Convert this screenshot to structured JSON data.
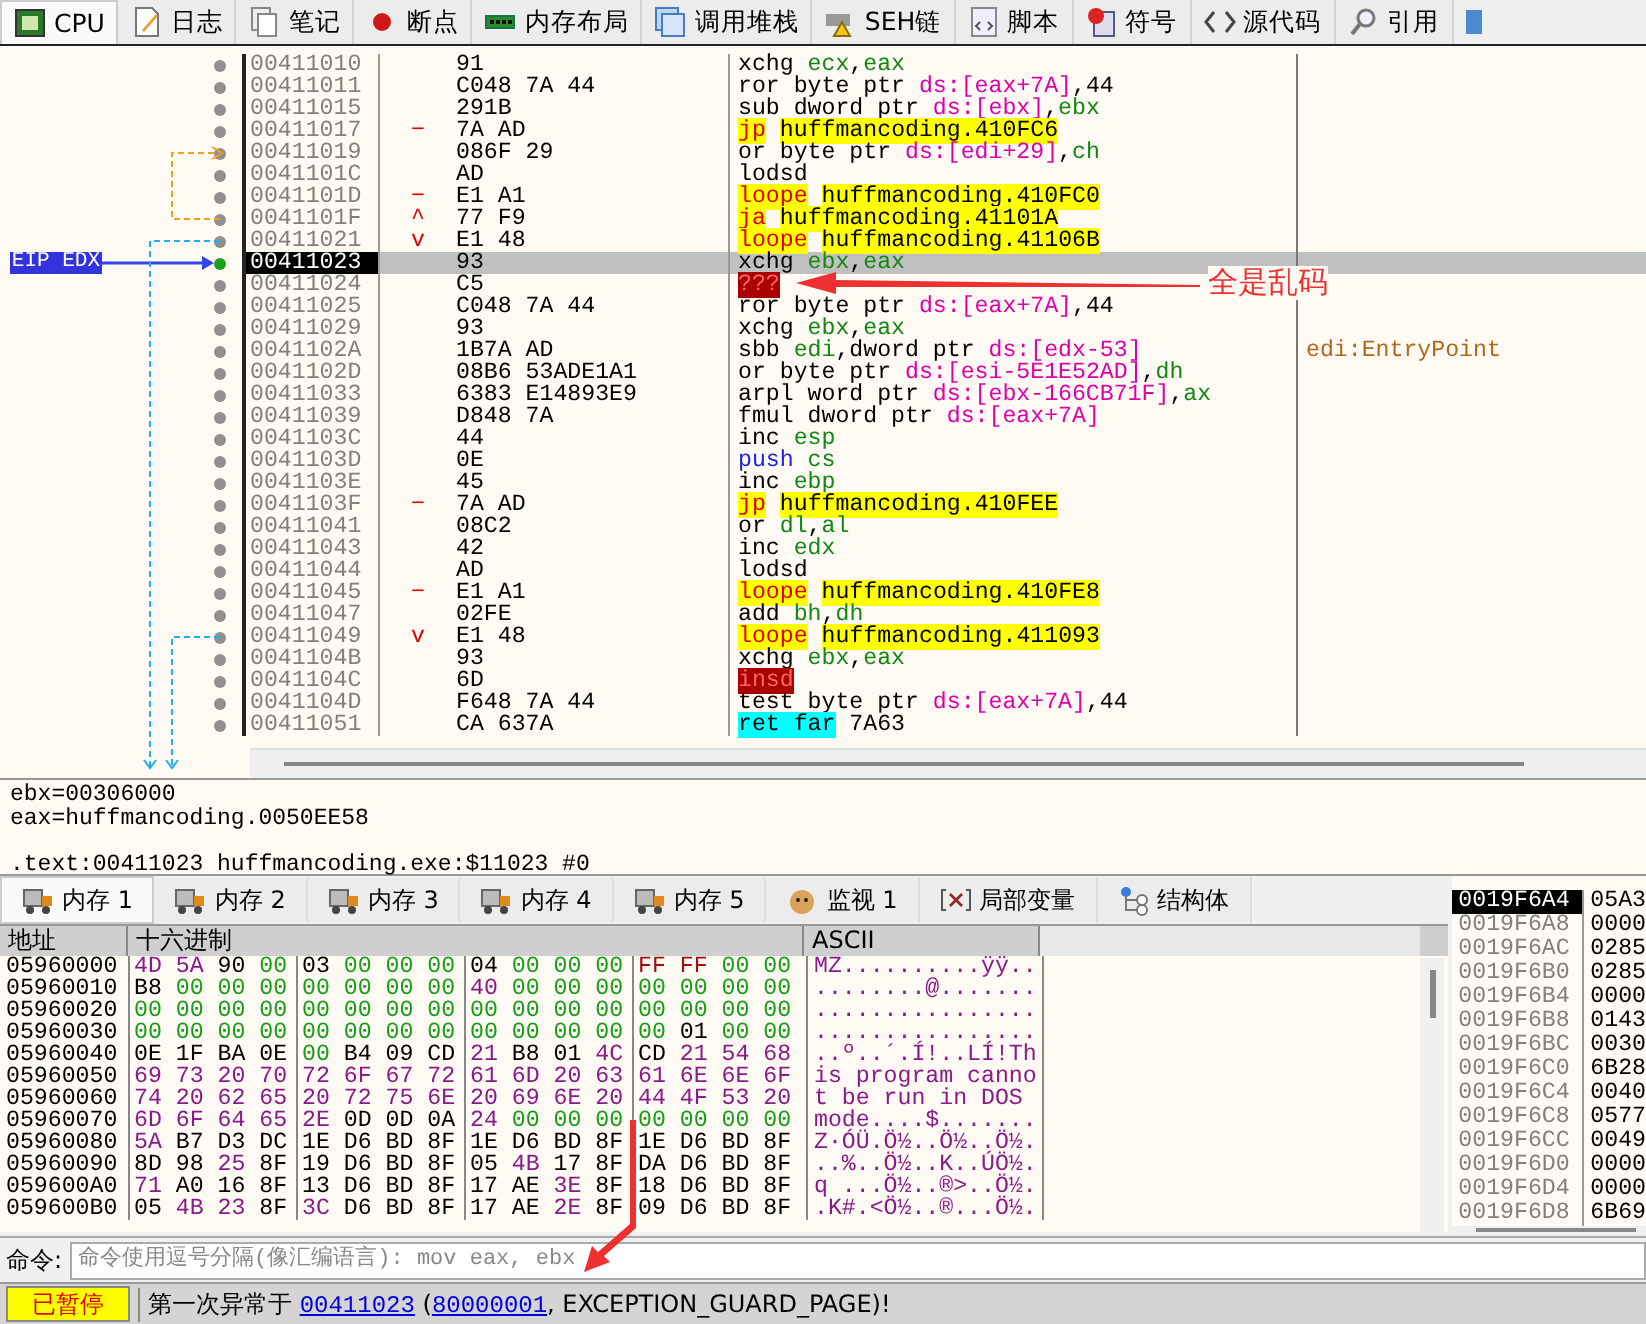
{
  "tabs": [
    {
      "label": "CPU",
      "selected": true
    },
    {
      "label": "日志",
      "selected": false
    },
    {
      "label": "笔记",
      "selected": false
    },
    {
      "label": "断点",
      "selected": false
    },
    {
      "label": "内存布局",
      "selected": false
    },
    {
      "label": "调用堆栈",
      "selected": false
    },
    {
      "label": "SEH链",
      "selected": false
    },
    {
      "label": "脚本",
      "selected": false
    },
    {
      "label": "符号",
      "selected": false
    },
    {
      "label": "源代码",
      "selected": false
    },
    {
      "label": "引用",
      "selected": false
    }
  ],
  "eip_label": "EIP EDX",
  "disassembly": [
    {
      "address": "00411010",
      "bytes": "91",
      "parts": [
        {
          "kind": "plain",
          "text": "xchg "
        },
        {
          "kind": "reg",
          "text": "ecx"
        },
        {
          "kind": "plain",
          "text": ","
        },
        {
          "kind": "reg",
          "text": "eax"
        }
      ],
      "selected": false
    },
    {
      "address": "00411011",
      "bytes": "C048 7A 44",
      "parts": [
        {
          "kind": "plain",
          "text": "ror byte ptr "
        },
        {
          "kind": "mem",
          "text": "ds:[eax+7A]"
        },
        {
          "kind": "plain",
          "text": ",44"
        }
      ],
      "selected": false
    },
    {
      "address": "00411015",
      "bytes": "291B",
      "parts": [
        {
          "kind": "plain",
          "text": "sub dword ptr "
        },
        {
          "kind": "mem",
          "text": "ds:[ebx]"
        },
        {
          "kind": "plain",
          "text": ","
        },
        {
          "kind": "reg",
          "text": "ebx"
        }
      ],
      "selected": false
    },
    {
      "address": "00411017",
      "jump": "−",
      "bytes": "7A AD",
      "parts": [
        {
          "kind": "jump",
          "text": "jp"
        },
        {
          "kind": "label",
          "text": "huffmancoding.410FC6"
        }
      ],
      "selected": false
    },
    {
      "address": "00411019",
      "bytes": "086F 29",
      "parts": [
        {
          "kind": "plain",
          "text": "or byte ptr "
        },
        {
          "kind": "mem",
          "text": "ds:[edi+29]"
        },
        {
          "kind": "plain",
          "text": ","
        },
        {
          "kind": "reg",
          "text": "ch"
        }
      ],
      "selected": false
    },
    {
      "address": "0041101C",
      "bytes": "AD",
      "parts": [
        {
          "kind": "plain",
          "text": "lodsd"
        }
      ],
      "selected": false
    },
    {
      "address": "0041101D",
      "jump": "−",
      "bytes": "E1 A1",
      "parts": [
        {
          "kind": "jump",
          "text": "loope"
        },
        {
          "kind": "label",
          "text": "huffmancoding.410FC0"
        }
      ],
      "selected": false
    },
    {
      "address": "0041101F",
      "jump": "^",
      "bytes": "77 F9",
      "parts": [
        {
          "kind": "jump",
          "text": "ja"
        },
        {
          "kind": "label",
          "text": "huffmancoding.41101A"
        }
      ],
      "selected": false
    },
    {
      "address": "00411021",
      "jump": "v",
      "bytes": "E1 48",
      "parts": [
        {
          "kind": "jump",
          "text": "loope"
        },
        {
          "kind": "label",
          "text": "huffmancoding.41106B"
        }
      ],
      "selected": false
    },
    {
      "address": "00411023",
      "bytes": "93",
      "parts": [
        {
          "kind": "plain",
          "text": "xchg "
        },
        {
          "kind": "reg",
          "text": "ebx"
        },
        {
          "kind": "plain",
          "text": ","
        },
        {
          "kind": "reg",
          "text": "eax"
        }
      ],
      "selected": true,
      "eip": true
    },
    {
      "address": "00411024",
      "bytes": "C5",
      "parts": [
        {
          "kind": "bad",
          "text": "???"
        }
      ],
      "selected": false
    },
    {
      "address": "00411025",
      "bytes": "C048 7A 44",
      "parts": [
        {
          "kind": "plain",
          "text": "ror byte ptr "
        },
        {
          "kind": "mem",
          "text": "ds:[eax+7A]"
        },
        {
          "kind": "plain",
          "text": ",44"
        }
      ],
      "selected": false
    },
    {
      "address": "00411029",
      "bytes": "93",
      "parts": [
        {
          "kind": "plain",
          "text": "xchg "
        },
        {
          "kind": "reg",
          "text": "ebx"
        },
        {
          "kind": "plain",
          "text": ","
        },
        {
          "kind": "reg",
          "text": "eax"
        }
      ],
      "selected": false
    },
    {
      "address": "0041102A",
      "bytes": "1B7A AD",
      "parts": [
        {
          "kind": "plain",
          "text": "sbb "
        },
        {
          "kind": "reg",
          "text": "edi"
        },
        {
          "kind": "plain",
          "text": ",dword ptr "
        },
        {
          "kind": "mem",
          "text": "ds:[edx-53]"
        }
      ],
      "comment": "edi:EntryPoint",
      "selected": false
    },
    {
      "address": "0041102D",
      "bytes": "08B6 53ADE1A1",
      "parts": [
        {
          "kind": "plain",
          "text": "or byte ptr "
        },
        {
          "kind": "mem",
          "text": "ds:[esi-5E1E52AD]"
        },
        {
          "kind": "plain",
          "text": ","
        },
        {
          "kind": "reg",
          "text": "dh"
        }
      ],
      "selected": false
    },
    {
      "address": "00411033",
      "bytes": "6383 E14893E9",
      "parts": [
        {
          "kind": "plain",
          "text": "arpl word ptr "
        },
        {
          "kind": "mem",
          "text": "ds:[ebx-166CB71F]"
        },
        {
          "kind": "plain",
          "text": ","
        },
        {
          "kind": "reg",
          "text": "ax"
        }
      ],
      "selected": false
    },
    {
      "address": "00411039",
      "bytes": "D848 7A",
      "parts": [
        {
          "kind": "plain",
          "text": "fmul dword ptr "
        },
        {
          "kind": "mem",
          "text": "ds:[eax+7A]"
        }
      ],
      "selected": false
    },
    {
      "address": "0041103C",
      "bytes": "44",
      "parts": [
        {
          "kind": "plain",
          "text": "inc "
        },
        {
          "kind": "reg",
          "text": "esp"
        }
      ],
      "selected": false
    },
    {
      "address": "0041103D",
      "bytes": "0E",
      "parts": [
        {
          "kind": "push",
          "text": "push "
        },
        {
          "kind": "reg",
          "text": "cs"
        }
      ],
      "selected": false
    },
    {
      "address": "0041103E",
      "bytes": "45",
      "parts": [
        {
          "kind": "plain",
          "text": "inc "
        },
        {
          "kind": "reg",
          "text": "ebp"
        }
      ],
      "selected": false
    },
    {
      "address": "0041103F",
      "jump": "−",
      "bytes": "7A AD",
      "parts": [
        {
          "kind": "jump",
          "text": "jp"
        },
        {
          "kind": "label",
          "text": "huffmancoding.410FEE"
        }
      ],
      "selected": false
    },
    {
      "address": "00411041",
      "bytes": "08C2",
      "parts": [
        {
          "kind": "plain",
          "text": "or "
        },
        {
          "kind": "reg",
          "text": "dl"
        },
        {
          "kind": "plain",
          "text": ","
        },
        {
          "kind": "reg",
          "text": "al"
        }
      ],
      "selected": false
    },
    {
      "address": "00411043",
      "bytes": "42",
      "parts": [
        {
          "kind": "plain",
          "text": "inc "
        },
        {
          "kind": "reg",
          "text": "edx"
        }
      ],
      "selected": false
    },
    {
      "address": "00411044",
      "bytes": "AD",
      "parts": [
        {
          "kind": "plain",
          "text": "lodsd"
        }
      ],
      "selected": false
    },
    {
      "address": "00411045",
      "jump": "−",
      "bytes": "E1 A1",
      "parts": [
        {
          "kind": "jump",
          "text": "loope"
        },
        {
          "kind": "label",
          "text": "huffmancoding.410FE8"
        }
      ],
      "selected": false
    },
    {
      "address": "00411047",
      "bytes": "02FE",
      "parts": [
        {
          "kind": "plain",
          "text": "add "
        },
        {
          "kind": "reg",
          "text": "bh"
        },
        {
          "kind": "plain",
          "text": ","
        },
        {
          "kind": "reg",
          "text": "dh"
        }
      ],
      "selected": false
    },
    {
      "address": "00411049",
      "jump": "v",
      "bytes": "E1 48",
      "parts": [
        {
          "kind": "jump",
          "text": "loope"
        },
        {
          "kind": "label",
          "text": "huffmancoding.411093"
        }
      ],
      "selected": false
    },
    {
      "address": "0041104B",
      "bytes": "93",
      "parts": [
        {
          "kind": "plain",
          "text": "xchg "
        },
        {
          "kind": "reg",
          "text": "ebx"
        },
        {
          "kind": "plain",
          "text": ","
        },
        {
          "kind": "reg",
          "text": "eax"
        }
      ],
      "selected": false
    },
    {
      "address": "0041104C",
      "bytes": "6D",
      "parts": [
        {
          "kind": "bad",
          "text": "insd"
        }
      ],
      "selected": false
    },
    {
      "address": "0041104D",
      "bytes": "F648 7A 44",
      "parts": [
        {
          "kind": "plain",
          "text": "test byte ptr "
        },
        {
          "kind": "mem",
          "text": "ds:[eax+7A]"
        },
        {
          "kind": "plain",
          "text": ",44"
        }
      ],
      "selected": false
    },
    {
      "address": "00411051",
      "bytes": "CA 637A",
      "parts": [
        {
          "kind": "ret",
          "text": "ret far"
        },
        {
          "kind": "plain",
          "text": " 7A63"
        }
      ],
      "selected": false
    }
  ],
  "info": {
    "registers": [
      "ebx=00306000",
      "eax=huffmancoding.0050EE58"
    ],
    "location": ".text:00411023 huffmancoding.exe:$11023 #0"
  },
  "memory_tabs": [
    {
      "label": "内存 1",
      "selected": true
    },
    {
      "label": "内存 2",
      "selected": false
    },
    {
      "label": "内存 3",
      "selected": false
    },
    {
      "label": "内存 4",
      "selected": false
    },
    {
      "label": "内存 5",
      "selected": false
    },
    {
      "label": "监视 1",
      "selected": false
    },
    {
      "label": "局部变量",
      "selected": false
    },
    {
      "label": "结构体",
      "selected": false
    }
  ],
  "dump": {
    "columns": [
      "地址",
      "十六进制",
      "ASCII"
    ],
    "rows": [
      {
        "address": "05960000",
        "hex": "4D 5A 90 00 03 00 00 00 04 00 00 00 FF FF 00 00",
        "ascii": "MZ..........ÿÿ.."
      },
      {
        "address": "05960010",
        "hex": "B8 00 00 00 00 00 00 00 40 00 00 00 00 00 00 00",
        "ascii": "........@......."
      },
      {
        "address": "05960020",
        "hex": "00 00 00 00 00 00 00 00 00 00 00 00 00 00 00 00",
        "ascii": "................"
      },
      {
        "address": "05960030",
        "hex": "00 00 00 00 00 00 00 00 00 00 00 00 00 01 00 00",
        "ascii": "................"
      },
      {
        "address": "05960040",
        "hex": "0E 1F BA 0E 00 B4 09 CD 21 B8 01 4C CD 21 54 68",
        "ascii": "..º..´.Í!..LÍ!Th"
      },
      {
        "address": "05960050",
        "hex": "69 73 20 70 72 6F 67 72 61 6D 20 63 61 6E 6E 6F",
        "ascii": "is program canno"
      },
      {
        "address": "05960060",
        "hex": "74 20 62 65 20 72 75 6E 20 69 6E 20 44 4F 53 20",
        "ascii": "t be run in DOS "
      },
      {
        "address": "05960070",
        "hex": "6D 6F 64 65 2E 0D 0D 0A 24 00 00 00 00 00 00 00",
        "ascii": "mode....$......."
      },
      {
        "address": "05960080",
        "hex": "5A B7 D3 DC 1E D6 BD 8F 1E D6 BD 8F 1E D6 BD 8F",
        "ascii": "Z·ÓÜ.Ö½..Ö½..Ö½."
      },
      {
        "address": "05960090",
        "hex": "8D 98 25 8F 19 D6 BD 8F 05 4B 17 8F DA D6 BD 8F",
        "ascii": "..%..Ö½..K..ÚÖ½."
      },
      {
        "address": "059600A0",
        "hex": "71 A0 16 8F 13 D6 BD 8F 17 AE 3E 8F 18 D6 BD 8F",
        "ascii": "q ...Ö½..®>..Ö½."
      },
      {
        "address": "059600B0",
        "hex": "05 4B 23 8F 3C D6 BD 8F 17 AE 2E 8F 09 D6 BD 8F",
        "ascii": ".K#.<Ö½..®...Ö½."
      }
    ]
  },
  "stack": [
    {
      "address": "0019F6A4",
      "value": "05A3",
      "selected": true
    },
    {
      "address": "0019F6A8",
      "value": "0000",
      "selected": false
    },
    {
      "address": "0019F6AC",
      "value": "0285",
      "selected": false
    },
    {
      "address": "0019F6B0",
      "value": "0285",
      "selected": false
    },
    {
      "address": "0019F6B4",
      "value": "0000",
      "selected": false
    },
    {
      "address": "0019F6B8",
      "value": "0143",
      "selected": false
    },
    {
      "address": "0019F6BC",
      "value": "0030",
      "selected": false
    },
    {
      "address": "0019F6C0",
      "value": "6B28",
      "selected": false
    },
    {
      "address": "0019F6C4",
      "value": "0040",
      "selected": false
    },
    {
      "address": "0019F6C8",
      "value": "0577",
      "selected": false
    },
    {
      "address": "0019F6CC",
      "value": "0049",
      "selected": false
    },
    {
      "address": "0019F6D0",
      "value": "0000",
      "selected": false
    },
    {
      "address": "0019F6D4",
      "value": "0000",
      "selected": false
    },
    {
      "address": "0019F6D8",
      "value": "6B69",
      "selected": false
    }
  ],
  "command": {
    "label": "命令:",
    "placeholder": "命令使用逗号分隔(像汇编语言): mov eax, ebx"
  },
  "status_bar": {
    "state": "已暂停",
    "parts": [
      {
        "kind": "text",
        "text": "第一次异常于 "
      },
      {
        "kind": "link",
        "text": "00411023"
      },
      {
        "kind": "text",
        "text": " ("
      },
      {
        "kind": "link",
        "text": "80000001"
      },
      {
        "kind": "text",
        "text": ", EXCEPTION_GUARD_PAGE)!"
      }
    ]
  },
  "annotation": {
    "text": "全是乱码"
  }
}
